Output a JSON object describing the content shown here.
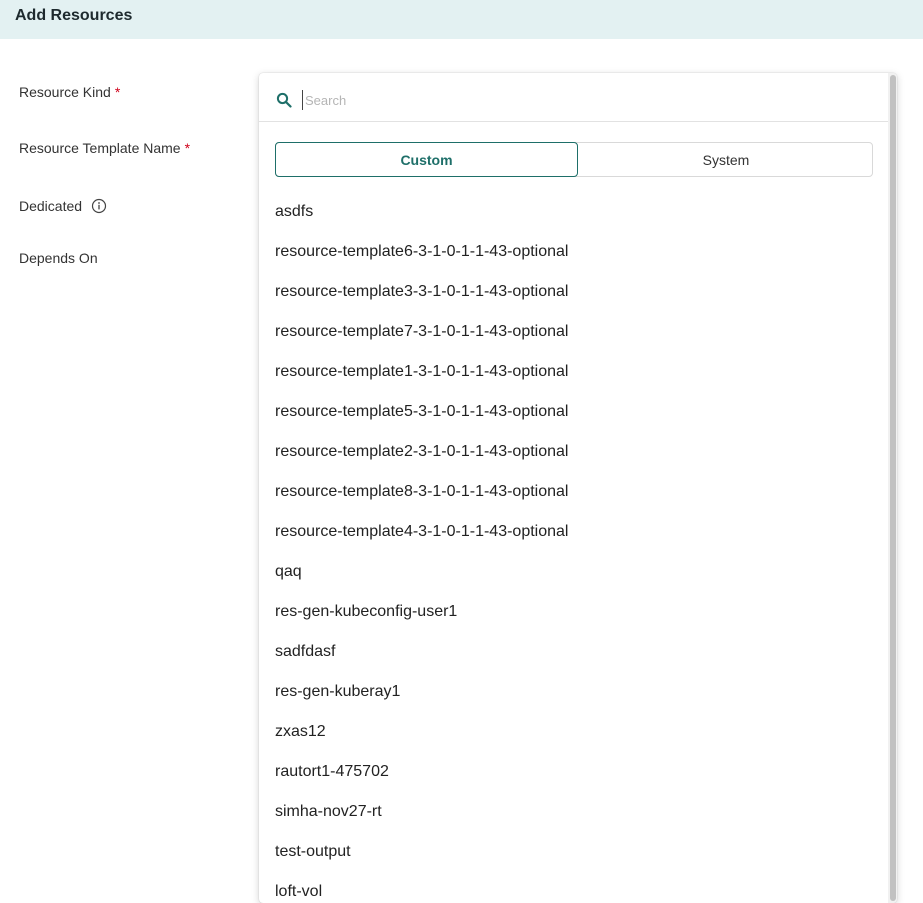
{
  "header": {
    "title": "Add Resources"
  },
  "form": {
    "resource_kind_label": "Resource Kind",
    "resource_template_name_label": "Resource Template Name",
    "dedicated_label": "Dedicated",
    "depends_on_label": "Depends On",
    "required_mark": "*"
  },
  "dropdown": {
    "search": {
      "placeholder": "Search",
      "value": ""
    },
    "tabs": {
      "custom": "Custom",
      "system": "System",
      "selected": "Custom"
    },
    "items": [
      "asdfs",
      "resource-template6-3-1-0-1-1-43-optional",
      "resource-template3-3-1-0-1-1-43-optional",
      "resource-template7-3-1-0-1-1-43-optional",
      "resource-template1-3-1-0-1-1-43-optional",
      "resource-template5-3-1-0-1-1-43-optional",
      "resource-template2-3-1-0-1-1-43-optional",
      "resource-template8-3-1-0-1-1-43-optional",
      "resource-template4-3-1-0-1-1-43-optional",
      "qaq",
      "res-gen-kubeconfig-user1",
      "sadfdasf",
      "res-gen-kuberay1",
      "zxas12",
      "rautort1-475702",
      "simha-nov27-rt",
      "test-output",
      "loft-vol"
    ]
  },
  "colors": {
    "accent": "#1e6f69",
    "header_bg": "#e3f1f2",
    "required": "#d0021b"
  }
}
